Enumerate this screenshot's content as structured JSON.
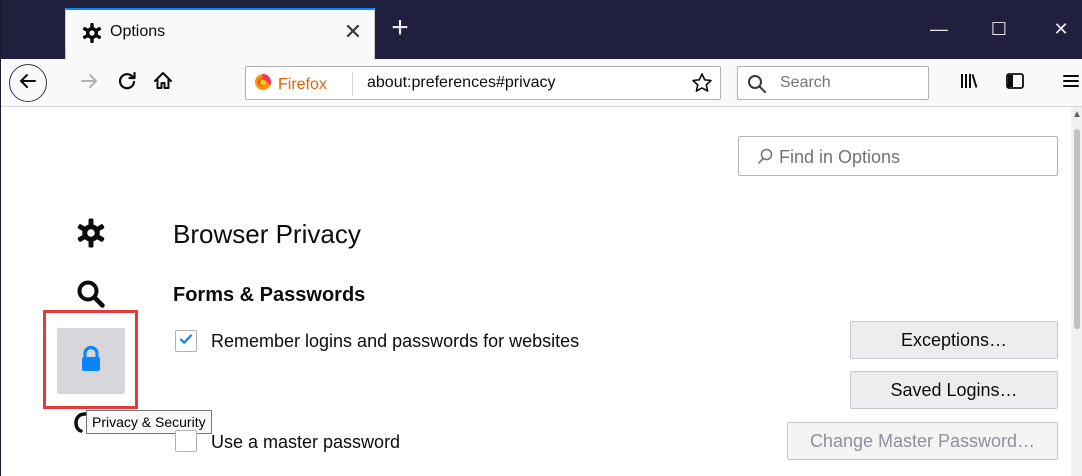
{
  "tab": {
    "title": "Options",
    "icon": "gear-icon"
  },
  "toolbar": {
    "new_tab_label": "+",
    "minimize_label": "—",
    "maximize_label": "☐",
    "close_label": "✕"
  },
  "navbar": {
    "identity_label": "Firefox",
    "url": "about:preferences#privacy",
    "search_placeholder": "Search"
  },
  "content": {
    "find_placeholder": "Find in Options",
    "heading": "Browser Privacy",
    "section_title": "Forms & Passwords",
    "remember_logins_label": "Remember logins and passwords for websites",
    "remember_logins_checked": true,
    "master_password_label": "Use a master password",
    "master_password_checked": false,
    "exceptions_button": "Exceptions…",
    "saved_logins_button": "Saved Logins…",
    "change_master_button": "Change Master Password…",
    "tooltip": "Privacy & Security"
  },
  "colors": {
    "accent": "#0a84ff",
    "tabbar": "#20203e",
    "highlight_border": "#e03c3c",
    "firefox_orange": "#e66000"
  },
  "sidebar": {
    "items": [
      {
        "name": "general",
        "icon": "gear-icon"
      },
      {
        "name": "search",
        "icon": "search-icon"
      },
      {
        "name": "privacy",
        "icon": "lock-icon",
        "selected": true
      },
      {
        "name": "sync",
        "icon": "sync-icon"
      }
    ]
  }
}
